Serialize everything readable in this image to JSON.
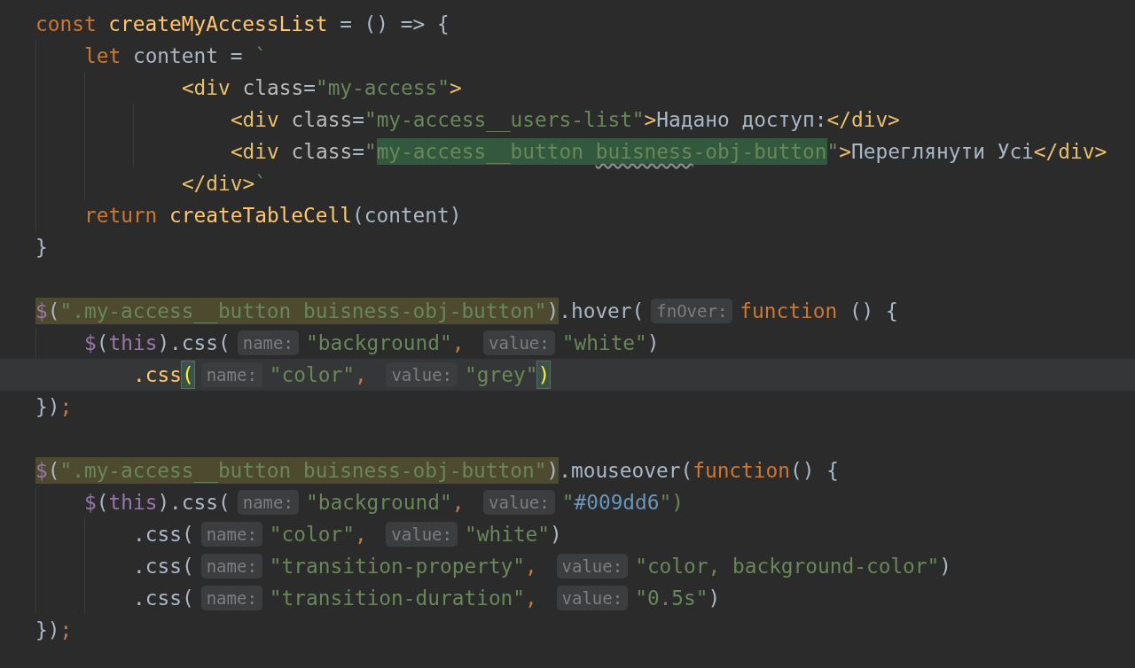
{
  "editor": {
    "lines": [
      {
        "tokens": [
          {
            "text": "const",
            "kind": "kw"
          },
          {
            "text": " createMyAccessList",
            "kind": "fn"
          },
          {
            "text": " = () => {",
            "kind": "plain"
          }
        ],
        "children": [
          {
            "tokens": [
              {
                "text": "let",
                "kind": "kw"
              },
              {
                "text": " content = ",
                "kind": "plain"
              },
              {
                "text": "`",
                "kind": "str"
              }
            ],
            "children": [
              {
                "tokens": [
                  {
                    "text": "    <div",
                    "kind": "tag"
                  },
                  {
                    "text": " class",
                    "kind": "attr"
                  },
                  {
                    "text": "=",
                    "kind": "plain"
                  },
                  {
                    "text": "\"my-access\"",
                    "kind": "str"
                  },
                  {
                    "text": ">",
                    "kind": "tag"
                  }
                ],
                "children": [
                  {
                    "tokens": [
                      {
                        "text": "    <div",
                        "kind": "tag"
                      },
                      {
                        "text": " class",
                        "kind": "attr"
                      },
                      {
                        "text": "=",
                        "kind": "plain"
                      },
                      {
                        "text": "\"my-access__users-list\"",
                        "kind": "str"
                      },
                      {
                        "text": ">",
                        "kind": "tag"
                      },
                      {
                        "text": "Надано доступ:",
                        "kind": "plain"
                      },
                      {
                        "text": "</div>",
                        "kind": "tag"
                      }
                    ]
                  },
                  {
                    "tokens": [
                      {
                        "text": "    <div",
                        "kind": "tag"
                      },
                      {
                        "text": " class",
                        "kind": "attr"
                      },
                      {
                        "text": "=",
                        "kind": "plain"
                      },
                      {
                        "text": "\"",
                        "kind": "str"
                      },
                      {
                        "text": "my-access__button ",
                        "kind": "str",
                        "matched": true
                      },
                      {
                        "text": "buisness",
                        "kind": "str",
                        "matched": true,
                        "typo": true
                      },
                      {
                        "text": "-obj-button",
                        "kind": "str",
                        "matched": true
                      },
                      {
                        "text": "\"",
                        "kind": "str"
                      },
                      {
                        "text": ">",
                        "kind": "tag"
                      },
                      {
                        "text": "Переглянути Усі",
                        "kind": "plain"
                      },
                      {
                        "text": "</div>",
                        "kind": "tag"
                      }
                    ]
                  }
                ]
              },
              {
                "tokens": [
                  {
                    "text": "    </div>",
                    "kind": "tag"
                  },
                  {
                    "text": "`",
                    "kind": "str"
                  }
                ]
              }
            ]
          },
          {
            "tokens": [
              {
                "text": "return",
                "kind": "kw"
              },
              {
                "text": " createTableCell",
                "kind": "fn"
              },
              {
                "text": "(content)",
                "kind": "plain"
              }
            ]
          }
        ]
      },
      {
        "tokens": [
          {
            "text": "}",
            "kind": "plain"
          }
        ]
      },
      {
        "kind": "blank"
      },
      {
        "tokens": [
          {
            "text": "$",
            "kind": "purple",
            "usage": true
          },
          {
            "text": "(",
            "kind": "plain",
            "usage": true
          },
          {
            "text": "\".my-access__button buisness-obj-button\"",
            "kind": "str",
            "usage": true
          },
          {
            "text": ")",
            "kind": "plain",
            "usage": true
          },
          {
            "text": ".hover(",
            "kind": "plain"
          },
          {
            "text": "fnOver:",
            "kind": "hint"
          },
          {
            "text": "function",
            "kind": "kw"
          },
          {
            "text": " () {",
            "kind": "plain"
          }
        ],
        "children": [
          {
            "tokens": [
              {
                "text": "$",
                "kind": "purple"
              },
              {
                "text": "(",
                "kind": "plain"
              },
              {
                "text": "this",
                "kind": "purple"
              },
              {
                "text": ").css(",
                "kind": "plain"
              },
              {
                "text": "name:",
                "kind": "hint"
              },
              {
                "text": "\"background\"",
                "kind": "str"
              },
              {
                "text": ", ",
                "kind": "punct"
              },
              {
                "text": "value:",
                "kind": "hint"
              },
              {
                "text": "\"white\"",
                "kind": "str"
              },
              {
                "text": ")",
                "kind": "plain"
              }
            ],
            "children": [
              {
                "current": true,
                "tokens": [
                  {
                    "text": ".css",
                    "kind": "fn"
                  },
                  {
                    "text": "(",
                    "kind": "plain",
                    "brace": true
                  },
                  {
                    "text": "name:",
                    "kind": "hint"
                  },
                  {
                    "text": "\"color\"",
                    "kind": "str"
                  },
                  {
                    "text": ", ",
                    "kind": "punct"
                  },
                  {
                    "text": "value:",
                    "kind": "hint"
                  },
                  {
                    "text": "\"grey\"",
                    "kind": "str"
                  },
                  {
                    "text": ")",
                    "kind": "plain",
                    "brace": true
                  }
                ]
              }
            ]
          }
        ]
      },
      {
        "tokens": [
          {
            "text": "})",
            "kind": "plain"
          },
          {
            "text": ";",
            "kind": "punct"
          }
        ]
      },
      {
        "kind": "blank"
      },
      {
        "tokens": [
          {
            "text": "$",
            "kind": "purple",
            "usage": true
          },
          {
            "text": "(",
            "kind": "plain",
            "usage": true
          },
          {
            "text": "\".my-access__button buisness-obj-button\"",
            "kind": "str",
            "usage": true
          },
          {
            "text": ")",
            "kind": "plain",
            "usage": true
          },
          {
            "text": ".mouseover(",
            "kind": "plain"
          },
          {
            "text": "function",
            "kind": "kw"
          },
          {
            "text": "() {",
            "kind": "plain"
          }
        ],
        "children": [
          {
            "tokens": [
              {
                "text": "$",
                "kind": "purple"
              },
              {
                "text": "(",
                "kind": "plain"
              },
              {
                "text": "this",
                "kind": "purple"
              },
              {
                "text": ").css(",
                "kind": "plain"
              },
              {
                "text": "name:",
                "kind": "hint"
              },
              {
                "text": "\"background\"",
                "kind": "str"
              },
              {
                "text": ", ",
                "kind": "punct"
              },
              {
                "text": "value:",
                "kind": "hint"
              },
              {
                "text": "\"",
                "kind": "str"
              },
              {
                "text": "#009dd6",
                "kind": "num"
              },
              {
                "text": "\")",
                "kind": "str"
              }
            ],
            "children": [
              {
                "tokens": [
                  {
                    "text": ".css(",
                    "kind": "plain"
                  },
                  {
                    "text": "name:",
                    "kind": "hint"
                  },
                  {
                    "text": "\"color\"",
                    "kind": "str"
                  },
                  {
                    "text": ", ",
                    "kind": "punct"
                  },
                  {
                    "text": "value:",
                    "kind": "hint"
                  },
                  {
                    "text": "\"white\"",
                    "kind": "str"
                  },
                  {
                    "text": ")",
                    "kind": "plain"
                  }
                ]
              },
              {
                "tokens": [
                  {
                    "text": ".css(",
                    "kind": "plain"
                  },
                  {
                    "text": "name:",
                    "kind": "hint"
                  },
                  {
                    "text": "\"transition-property\"",
                    "kind": "str"
                  },
                  {
                    "text": ", ",
                    "kind": "punct"
                  },
                  {
                    "text": "value:",
                    "kind": "hint"
                  },
                  {
                    "text": "\"color, background-color\"",
                    "kind": "str"
                  },
                  {
                    "text": ")",
                    "kind": "plain"
                  }
                ]
              },
              {
                "tokens": [
                  {
                    "text": ".css(",
                    "kind": "plain"
                  },
                  {
                    "text": "name:",
                    "kind": "hint"
                  },
                  {
                    "text": "\"transition-duration\"",
                    "kind": "str"
                  },
                  {
                    "text": ", ",
                    "kind": "punct"
                  },
                  {
                    "text": "value:",
                    "kind": "hint"
                  },
                  {
                    "text": "\"0.5s\"",
                    "kind": "str"
                  },
                  {
                    "text": ")",
                    "kind": "plain"
                  }
                ]
              }
            ]
          }
        ]
      },
      {
        "tokens": [
          {
            "text": "})",
            "kind": "plain"
          },
          {
            "text": ";",
            "kind": "punct"
          }
        ]
      }
    ]
  }
}
